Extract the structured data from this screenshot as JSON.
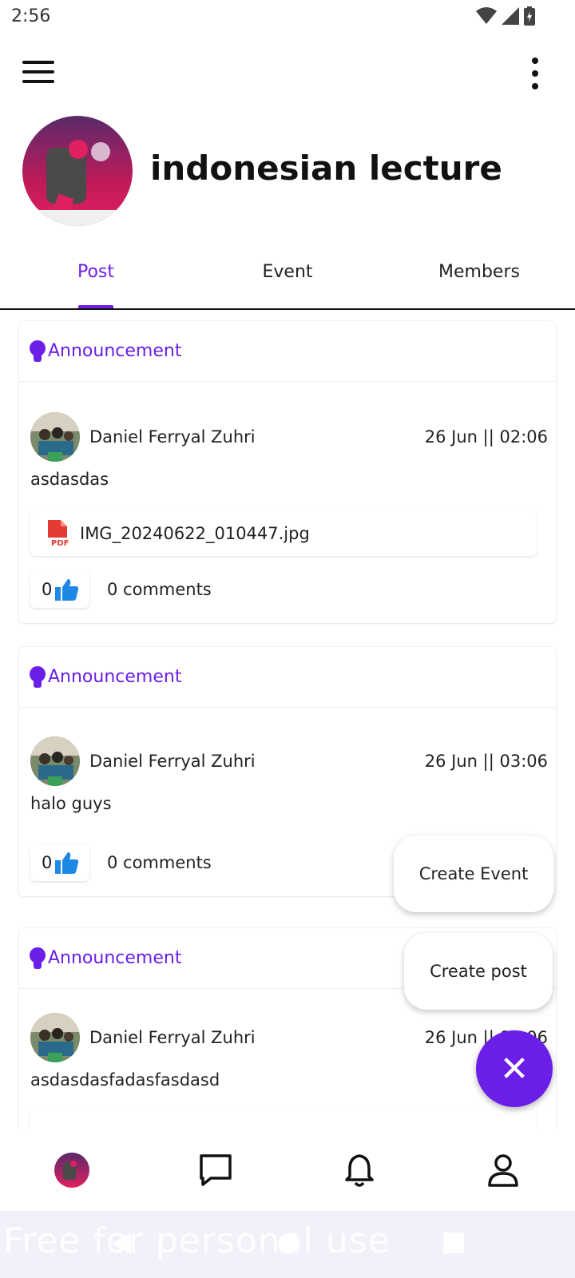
{
  "status_bar": {
    "time": "2:56"
  },
  "group": {
    "name": "indonesian lecture"
  },
  "tabs": [
    {
      "label": "Post",
      "active": true
    },
    {
      "label": "Event",
      "active": false
    },
    {
      "label": "Members",
      "active": false
    }
  ],
  "posts": [
    {
      "category": "Announcement",
      "author": "Daniel Ferryal Zuhri",
      "time": "26 Jun || 02:06",
      "text": "asdasdas",
      "attachment": "IMG_20240622_010447.jpg",
      "likes": "0",
      "comments": "0 comments"
    },
    {
      "category": "Announcement",
      "author": "Daniel Ferryal Zuhri",
      "time": "26 Jun || 03:06",
      "text": "halo guys",
      "likes": "0",
      "comments": "0 comments"
    },
    {
      "category": "Announcement",
      "author": "Daniel Ferryal Zuhri",
      "time": "26 Jun || 03:06",
      "text": "asdasdasfadasfasdasd"
    }
  ],
  "fab_menu": {
    "create_event": "Create Event",
    "create_post": "Create post",
    "close_symbol": "✕"
  },
  "bottom_nav": [
    "group-avatar",
    "chat-icon",
    "bell-icon",
    "profile-icon"
  ],
  "watermark": "Free for personal use",
  "colors": {
    "accent": "#6a1ee8",
    "like_blue": "#1e88e5",
    "pdf_red": "#e53935"
  }
}
